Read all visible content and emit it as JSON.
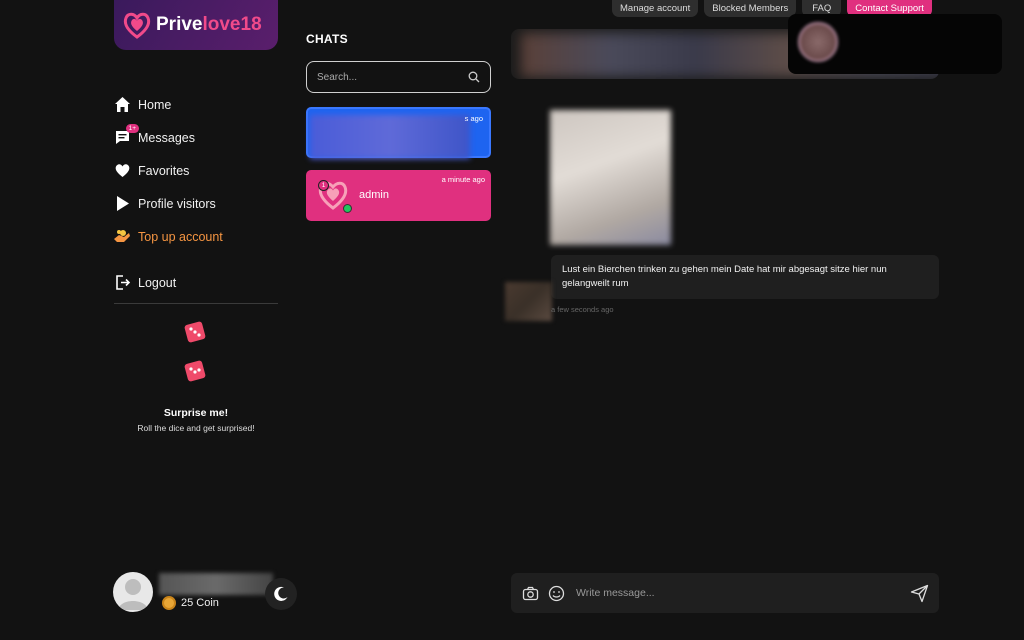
{
  "topbar": {
    "manage_account": "Manage account",
    "blocked_members": "Blocked Members",
    "faq": "FAQ",
    "contact_support": "Contact Support"
  },
  "brand": {
    "name_part1": "Prive",
    "name_part2": "love18",
    "accent": "#f14a8a"
  },
  "sidebar": {
    "items": [
      {
        "label": "Home",
        "icon": "home-icon"
      },
      {
        "label": "Messages",
        "icon": "chat-icon",
        "badge": "1+"
      },
      {
        "label": "Favorites",
        "icon": "heart-icon"
      },
      {
        "label": "Profile visitors",
        "icon": "play-icon"
      },
      {
        "label": "Top up account",
        "icon": "coins-icon"
      }
    ],
    "logout": "Logout"
  },
  "surprise": {
    "title": "Surprise me!",
    "subtitle": "Roll the dice and get surprised!"
  },
  "profile": {
    "coins": "25 Coin"
  },
  "chats": {
    "title": "CHATS",
    "search_placeholder": "Search...",
    "list": [
      {
        "name": "",
        "time": "s ago",
        "active": true
      },
      {
        "name": "admin",
        "time": "a minute ago",
        "unread": "1"
      }
    ]
  },
  "conversation": {
    "message_text": "Lust ein Bierchen trinken zu gehen mein Date hat mir abgesagt sitze hier nun gelangweilt rum",
    "message_time": "a few seconds ago",
    "composer_placeholder": "Write message..."
  },
  "colors": {
    "pink": "#e0307f",
    "blue": "#1e64f0",
    "orange": "#f59542",
    "bg": "#121212"
  }
}
